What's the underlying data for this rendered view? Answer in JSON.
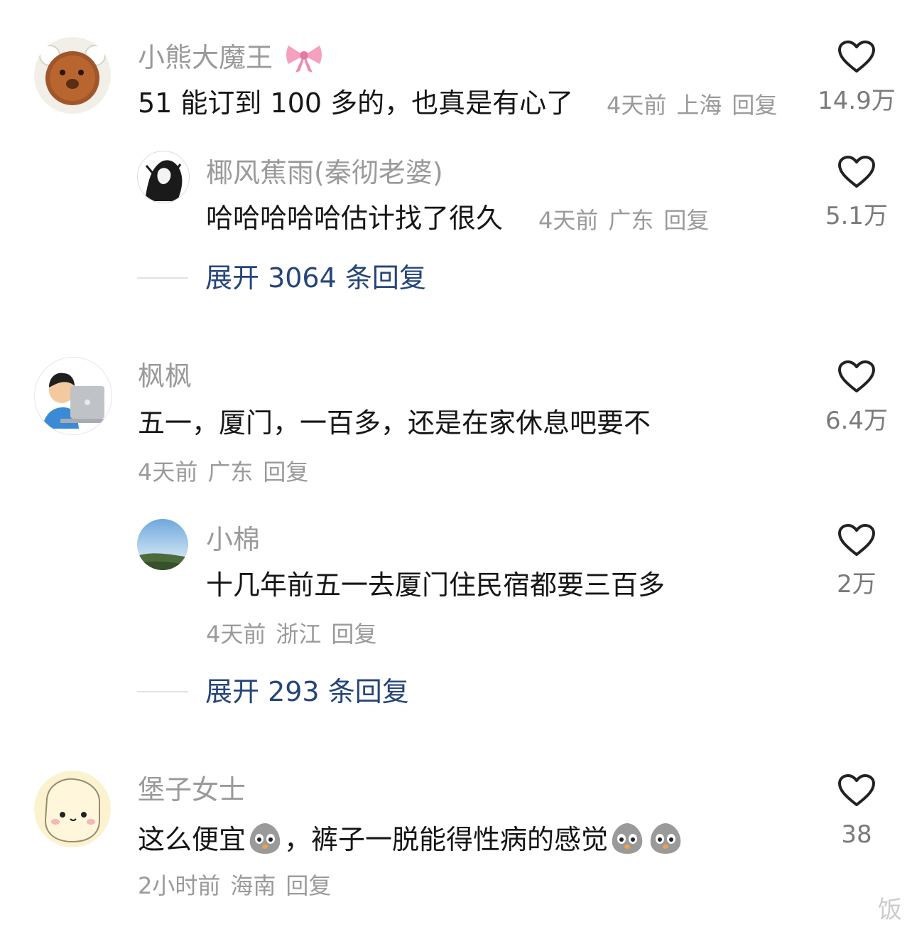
{
  "comments": [
    {
      "name": "小熊大魔王",
      "text": "51 能订到 100 多的，也真是有心了",
      "meta": {
        "time": "4天前",
        "location": "上海",
        "reply": "回复"
      },
      "likes": "14.9万",
      "replies": [
        {
          "name": "椰风蕉雨(秦彻老婆)",
          "text": "哈哈哈哈哈估计找了很久",
          "meta": {
            "time": "4天前",
            "location": "广东",
            "reply": "回复"
          },
          "likes": "5.1万"
        }
      ],
      "expand_label": "展开 3064 条回复"
    },
    {
      "name": "枫枫",
      "text": "五一，厦门，一百多，还是在家休息吧要不",
      "meta": {
        "time": "4天前",
        "location": "广东",
        "reply": "回复"
      },
      "likes": "6.4万",
      "replies": [
        {
          "name": "小棉",
          "text": "十几年前五一去厦门住民宿都要三百多",
          "meta": {
            "time": "4天前",
            "location": "浙江",
            "reply": "回复"
          },
          "likes": "2万"
        }
      ],
      "expand_label": "展开 293 条回复"
    },
    {
      "name": "堡子女士",
      "text_parts": [
        "这么便宜",
        "，裤子一脱能得性病的感觉"
      ],
      "meta": {
        "time": "2小时前",
        "location": "海南",
        "reply": "回复"
      },
      "likes": "38"
    }
  ],
  "icons": {
    "like": "heart-outline-icon",
    "emoji": "crying-face-emoji-icon",
    "bow": "pink-bow-emoji-icon"
  },
  "colors": {
    "name": "#9a9a9a",
    "text": "#161616",
    "expand": "#25457a",
    "heart": "#222222"
  },
  "watermark": "饭"
}
